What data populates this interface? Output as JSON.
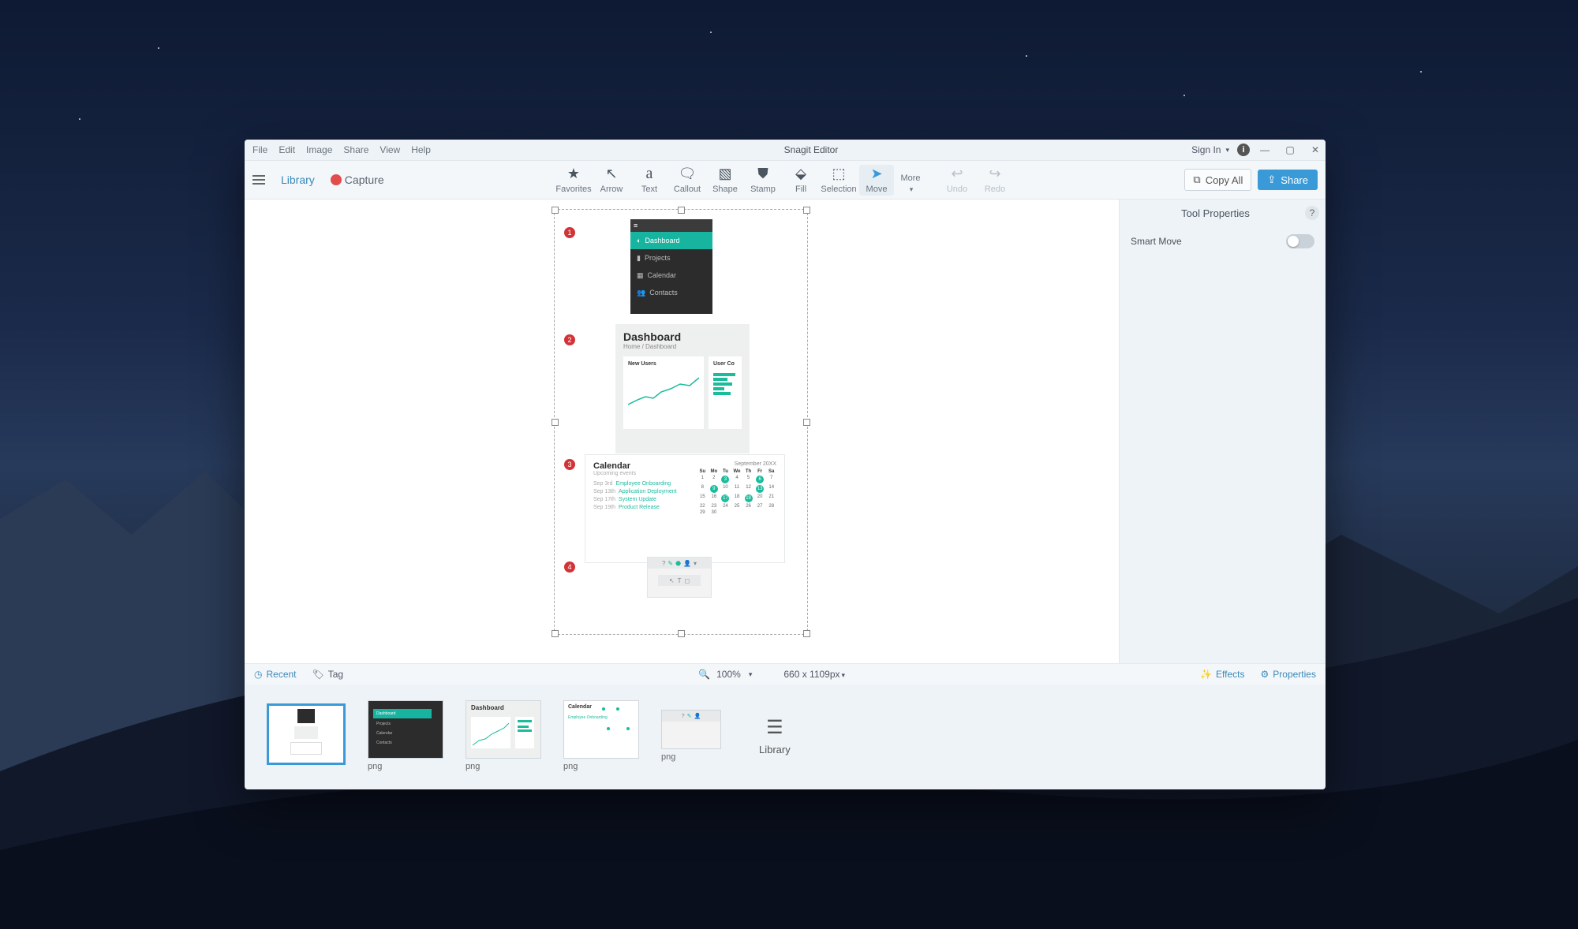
{
  "window": {
    "title": "Snagit Editor",
    "menus": [
      "File",
      "Edit",
      "Image",
      "Share",
      "View",
      "Help"
    ],
    "sign_in": "Sign In",
    "controls": {
      "minimize": "—",
      "maximize": "▢",
      "close": "✕"
    }
  },
  "toolbar_left": {
    "library": "Library",
    "capture": "Capture"
  },
  "tools": [
    {
      "id": "favorites",
      "label": "Favorites",
      "glyph": "★"
    },
    {
      "id": "arrow",
      "label": "Arrow",
      "glyph": "↖"
    },
    {
      "id": "text",
      "label": "Text",
      "glyph": "a"
    },
    {
      "id": "callout",
      "label": "Callout",
      "glyph": "🗨"
    },
    {
      "id": "shape",
      "label": "Shape",
      "glyph": "▧"
    },
    {
      "id": "stamp",
      "label": "Stamp",
      "glyph": "⛊"
    },
    {
      "id": "fill",
      "label": "Fill",
      "glyph": "⬙"
    },
    {
      "id": "selection",
      "label": "Selection",
      "glyph": "⬚"
    },
    {
      "id": "move",
      "label": "Move",
      "glyph": "➤",
      "selected": true
    },
    {
      "id": "more",
      "label": "More",
      "glyph": ""
    }
  ],
  "undo": "Undo",
  "redo": "Redo",
  "toolbar_right": {
    "copy_all": "Copy All",
    "share": "Share"
  },
  "side_panel": {
    "title": "Tool Properties",
    "smart_move": "Smart Move"
  },
  "canvas": {
    "steps": {
      "step1": {
        "num": "1",
        "items": [
          "Dashboard",
          "Projects",
          "Calendar",
          "Contacts"
        ]
      },
      "step2": {
        "num": "2",
        "title": "Dashboard",
        "breadcrumb": "Home / Dashboard",
        "card_a": "New Users",
        "card_b": "User Co"
      },
      "step3": {
        "num": "3",
        "title": "Calendar",
        "sub": "Upcoming events",
        "month": "September 20XX",
        "events": [
          {
            "t": "Sep 3rd",
            "l": "Employee Onboarding"
          },
          {
            "t": "Sep 13th",
            "l": "Application Deployment"
          },
          {
            "t": "Sep 17th",
            "l": "System Update"
          },
          {
            "t": "Sep 19th",
            "l": "Product Release"
          }
        ],
        "day_headers": [
          "Su",
          "Mo",
          "Tu",
          "We",
          "Th",
          "Fr",
          "Sa"
        ]
      },
      "step4": {
        "num": "4"
      }
    }
  },
  "statusbar": {
    "recent": "Recent",
    "tag": "Tag",
    "zoom": "100%",
    "dimensions": "660 x 1109px",
    "effects": "Effects",
    "properties": "Properties"
  },
  "thumbs": [
    {
      "label": ""
    },
    {
      "label": "png"
    },
    {
      "label": "png"
    },
    {
      "label": "png"
    },
    {
      "label": "png"
    }
  ],
  "library_button": "Library"
}
